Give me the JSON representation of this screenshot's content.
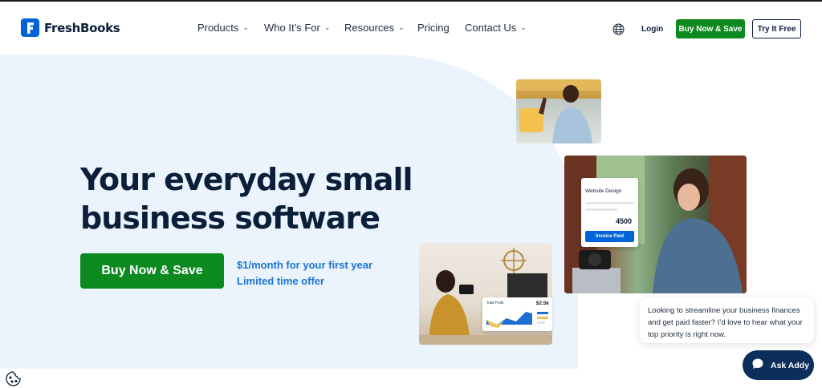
{
  "header": {
    "logo_text": "FreshBooks",
    "nav": [
      {
        "label": "Products"
      },
      {
        "label": "Who It’s For"
      },
      {
        "label": "Resources"
      },
      {
        "label": "Pricing"
      },
      {
        "label": "Contact Us"
      }
    ],
    "login_label": "Login",
    "buy_label": "Buy Now & Save",
    "try_label": "Try It Free"
  },
  "hero": {
    "headline": "Your everyday small business software",
    "cta_label": "Buy Now & Save",
    "offer_line1": "$1/month for your first year",
    "offer_line2": "Limited time offer"
  },
  "cards": {
    "invoice_title": "Website Design",
    "invoice_amount": "4500",
    "invoice_status": "Invoice Paid",
    "profit_title": "Total Profit",
    "profit_value": "$2.5k"
  },
  "chat": {
    "message": "Looking to streamline your business finances and get paid faster? I’d love to hear what your top priority is right now.",
    "button_label": "Ask Addy"
  },
  "colors": {
    "brand_blue": "#0063d7",
    "cta_green": "#0c8a1f",
    "navy": "#0b1f3a",
    "hero_bg": "#ebf4fd",
    "offer_blue": "#1a73d1"
  },
  "icons": [
    "freshbooks-logo-icon",
    "chevron-down-icon",
    "globe-icon",
    "chat-icon",
    "cookie-icon"
  ]
}
